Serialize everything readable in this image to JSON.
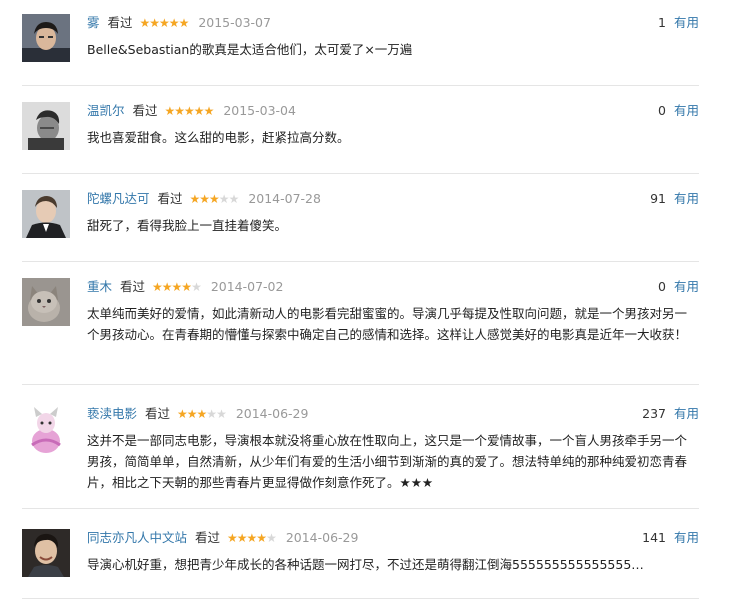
{
  "reviews": [
    {
      "author": "雾",
      "watched": "看过",
      "rating": 5,
      "date": "2015-03-07",
      "votes": "1",
      "useful_label": "有用",
      "text": "Belle&Sebastian的歌真是太适合他们，太可爱了×一万遍",
      "avatar": "portrait-dark-hair-icon"
    },
    {
      "author": "温凯尔",
      "watched": "看过",
      "rating": 5,
      "date": "2015-03-04",
      "votes": "0",
      "useful_label": "有用",
      "text": "我也喜爱甜食。这么甜的电影，赶紧拉高分数。",
      "avatar": "portrait-bw-icon"
    },
    {
      "author": "陀螺凡达可",
      "watched": "看过",
      "rating": 3,
      "date": "2014-07-28",
      "votes": "91",
      "useful_label": "有用",
      "text": "甜死了，看得我脸上一直挂着傻笑。",
      "avatar": "portrait-suit-icon"
    },
    {
      "author": "重木",
      "watched": "看过",
      "rating": 4,
      "date": "2014-07-02",
      "votes": "0",
      "useful_label": "有用",
      "text": "太单纯而美好的爱情，如此清新动人的电影看完甜蜜蜜的。导演几乎每提及性取向问题，就是一个男孩对另一个男孩动心。在青春期的懵懂与探索中确定自己的感情和选择。这样让人感觉美好的电影真是近年一大收获！",
      "avatar": "cat-icon"
    },
    {
      "author": "亵渎电影",
      "watched": "看过",
      "rating": 3,
      "date": "2014-06-29",
      "votes": "237",
      "useful_label": "有用",
      "text": "这并不是一部同志电影，导演根本就没将重心放在性取向上，这只是一个爱情故事，一个盲人男孩牵手另一个男孩，简简单单，自然清新，从少年们有爱的生活小细节到渐渐的真的爱了。想法特单纯的那种纯爱初恋青春片，相比之下天朝的那些青春片更显得做作刻意作死了。★★★",
      "avatar": "pink-figure-icon"
    },
    {
      "author": "同志亦凡人中文站",
      "watched": "看过",
      "rating": 4,
      "date": "2014-06-29",
      "votes": "141",
      "useful_label": "有用",
      "text": "导演心机好重，想把青少年成长的各种话题一网打尽，不过还是萌得翻江倒海555555555555555…",
      "avatar": "portrait-smiling-icon"
    }
  ],
  "colors": {
    "link": "#3377aa",
    "star": "#f5a623",
    "star_off": "#d8d8d8",
    "date": "#999999",
    "divider": "#e5e5e5"
  }
}
